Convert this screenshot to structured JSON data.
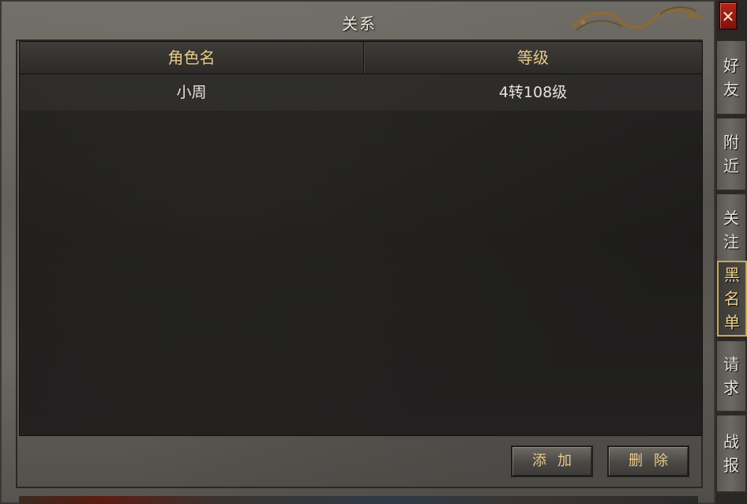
{
  "window": {
    "title": "关系",
    "close_label": "✕"
  },
  "table": {
    "headers": [
      "角色名",
      "等级"
    ],
    "rows": [
      {
        "name": "小周",
        "level": "4转108级"
      }
    ]
  },
  "buttons": {
    "add_label": "添加",
    "delete_label": "删除"
  },
  "tabs": [
    {
      "label": "好友",
      "chars": [
        "好",
        "友"
      ],
      "active": false
    },
    {
      "label": "附近",
      "chars": [
        "附",
        "近"
      ],
      "active": false
    },
    {
      "label": "关注",
      "chars": [
        "关",
        "注"
      ],
      "active": false
    },
    {
      "label": "黑名单",
      "chars": [
        "黑",
        "名",
        "单"
      ],
      "active": true
    },
    {
      "label": "请求",
      "chars": [
        "请",
        "求"
      ],
      "active": false
    },
    {
      "label": "战报",
      "chars": [
        "战",
        "报"
      ],
      "active": false
    }
  ],
  "colors": {
    "header_text": "#e8c98a",
    "active_tab_border": "#c8a860",
    "close_button": "#b5261b"
  }
}
